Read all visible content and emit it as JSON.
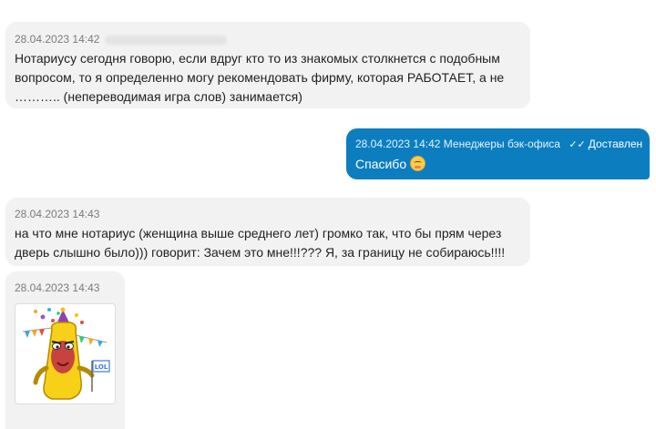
{
  "messages": [
    {
      "timestamp": "28.04.2023 14:42",
      "lines": [
        "Нотариусу сегодня говорю, если вдруг кто то из знакомых столкнется с подобным",
        "вопросом, то я определенно могу рекомендовать фирму, которая РАБОТАЕТ, а не",
        "……….. (непереводимая игра слов) занимается)"
      ]
    },
    {
      "timestamp": "28.04.2023 14:42",
      "sender": "Менеджеры бэк-офиса",
      "status": "Доставлен",
      "text": "Спасибо",
      "emoji": "smiling-face-icon"
    },
    {
      "timestamp": "28.04.2023 14:43",
      "lines": [
        "на что мне нотариус (женщина выше среднего лет) громко так, что бы прям через",
        "дверь слышно было))) говорит: Зачем это мне!!!??? Я, за границу не собираюсь!!!!"
      ]
    },
    {
      "timestamp": "28.04.2023 14:43",
      "sticker": {
        "name": "banana-lol-sticker",
        "flag_text": "LOL"
      }
    }
  ],
  "colors": {
    "incoming_bg": "#f2f2f2",
    "outgoing_bg": "#0c7ec0"
  }
}
